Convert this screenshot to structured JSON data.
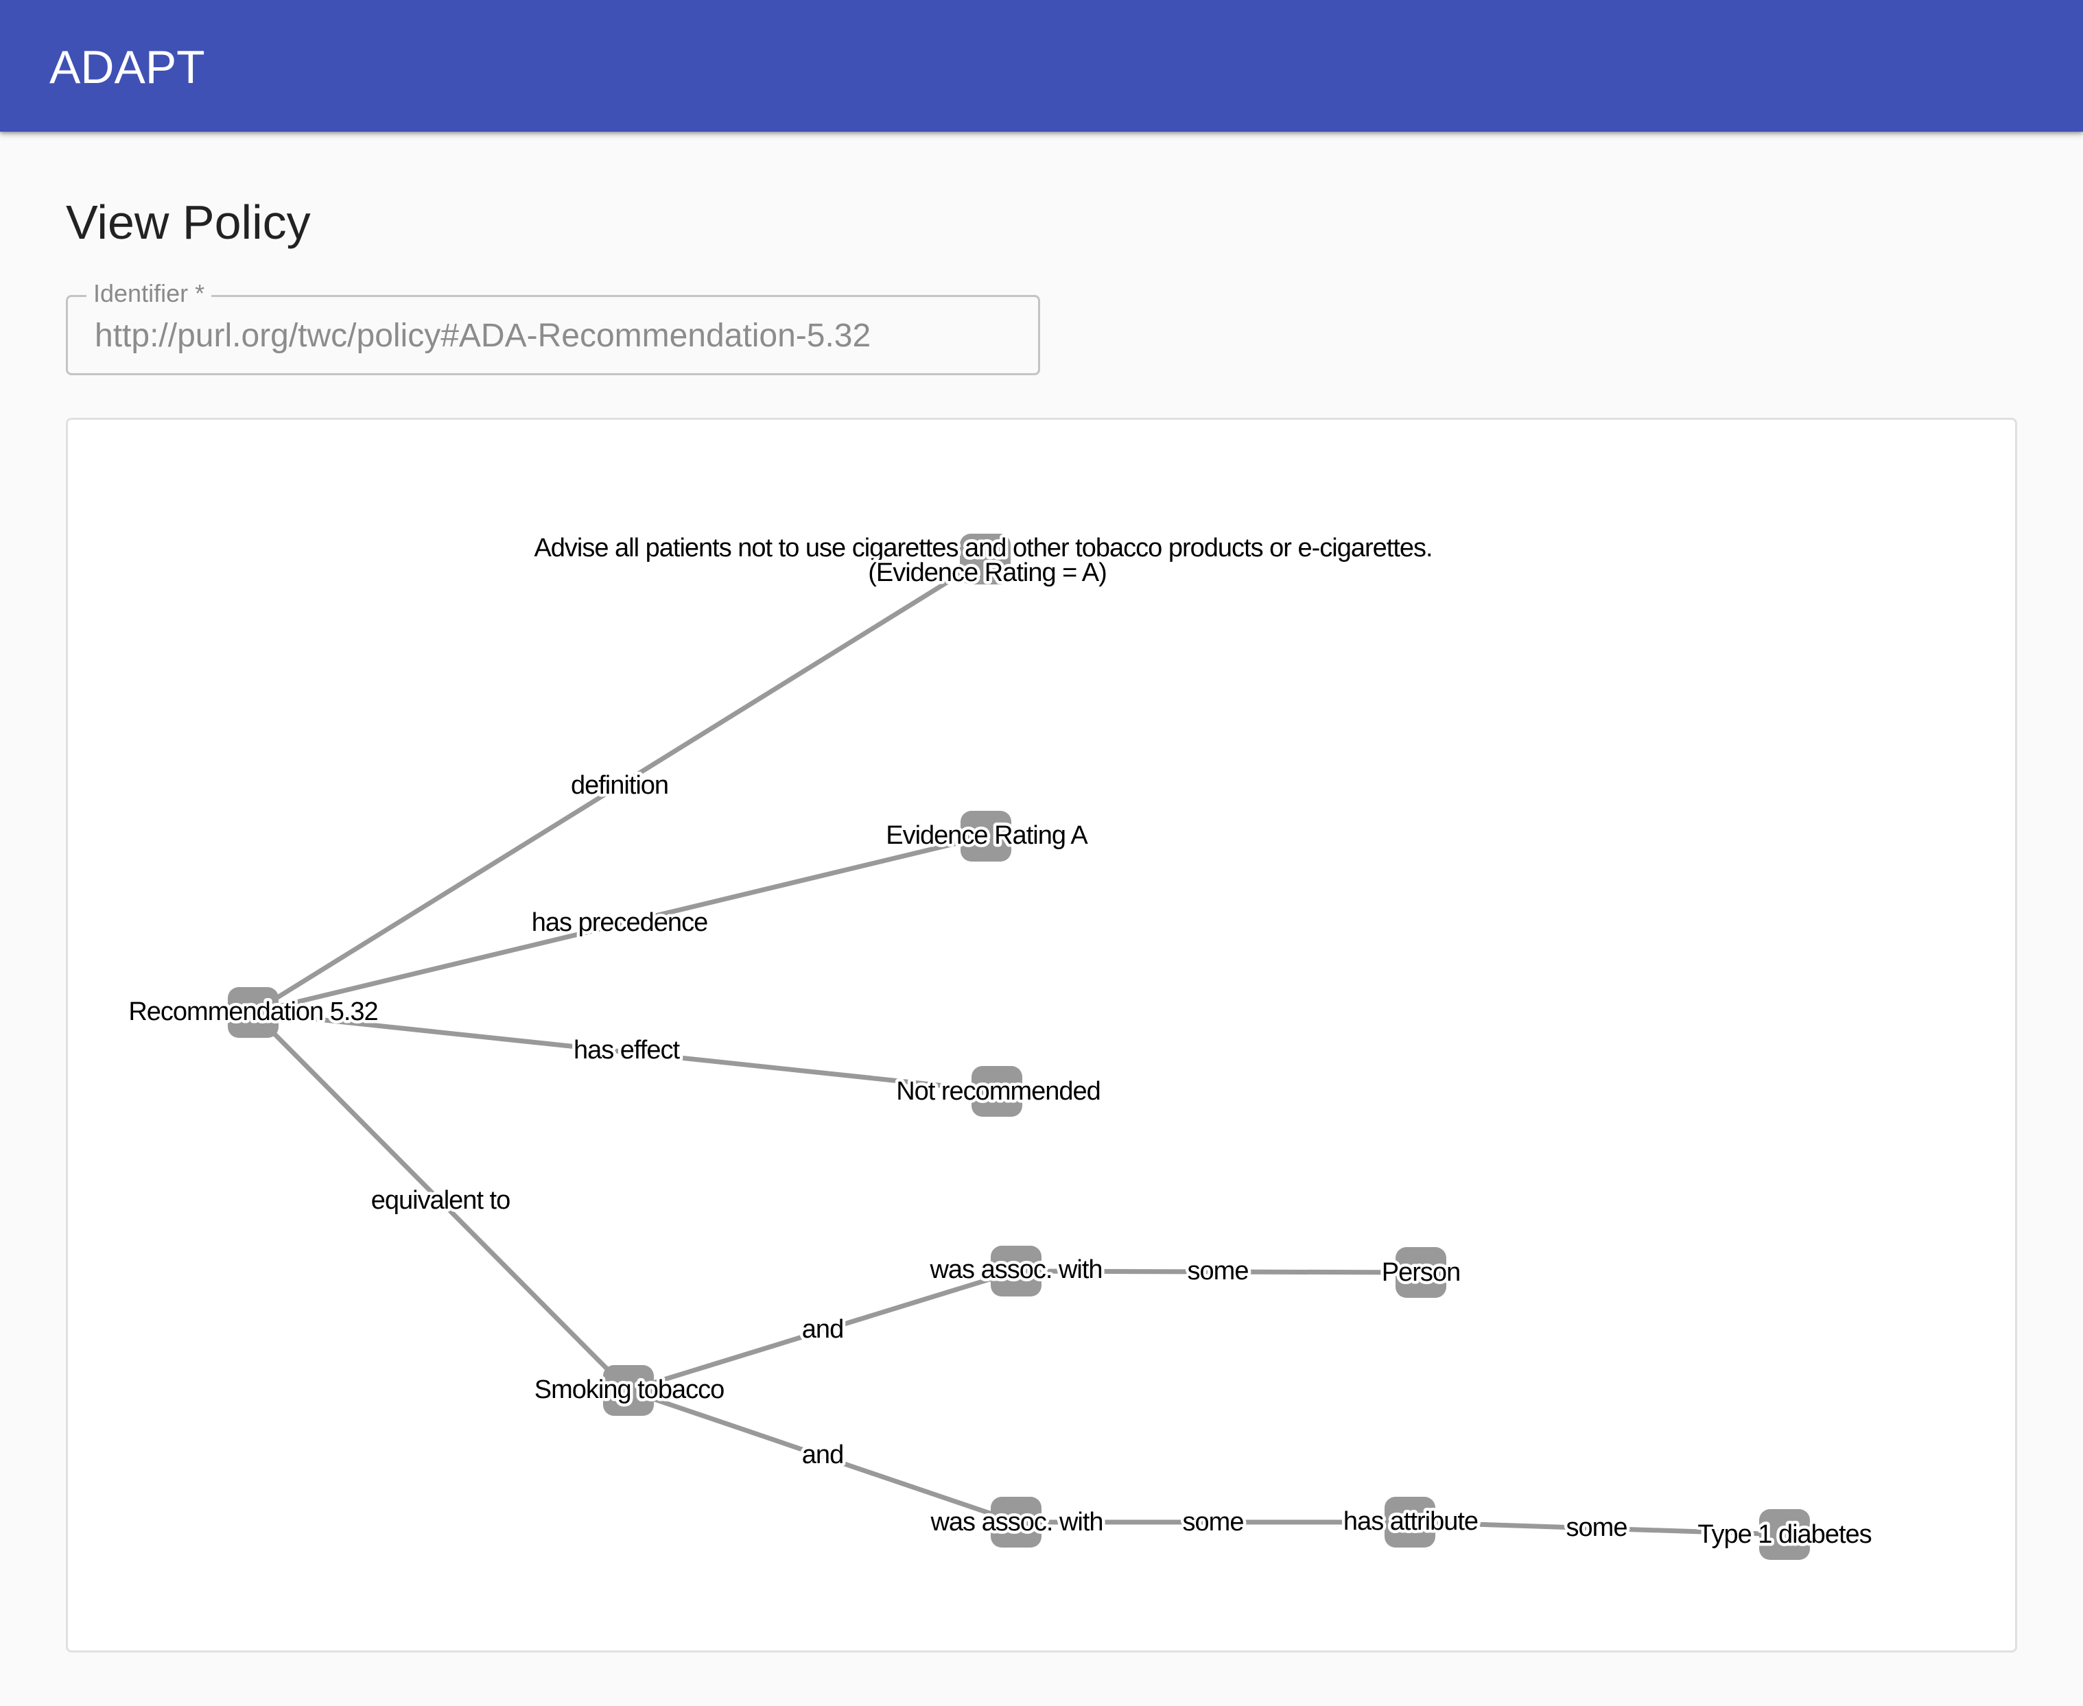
{
  "app": {
    "title": "ADAPT"
  },
  "page": {
    "title": "View Policy"
  },
  "identifier": {
    "label": "Identifier *",
    "value": "http://purl.org/twc/policy#ADA-Recommendation-5.32"
  },
  "graph": {
    "nodes": {
      "root": "Recommendation 5.32",
      "definition_line1": "Advise all patients not to use cigarettes and other tobacco products or e-cigarettes.",
      "definition_line2": "(Evidence Rating = A)",
      "evidence": "Evidence Rating A",
      "effect": "Not recommended",
      "smoking": "Smoking tobacco",
      "assoc_upper": "was assoc. with",
      "person": "Person",
      "assoc_lower": "was assoc. with",
      "has_attribute": "has attribute",
      "diabetes": "Type 1 diabetes"
    },
    "edges": {
      "definition": "definition",
      "has_precedence": "has precedence",
      "has_effect": "has effect",
      "equivalent_to": "equivalent to",
      "and_upper": "and",
      "and_lower": "and",
      "some_person": "some",
      "some_attribute": "some",
      "some_diabetes": "some"
    },
    "colors": {
      "edge": "#999999",
      "node": "#999999",
      "label_fill": "#000000",
      "label_halo": "#ffffff"
    }
  }
}
